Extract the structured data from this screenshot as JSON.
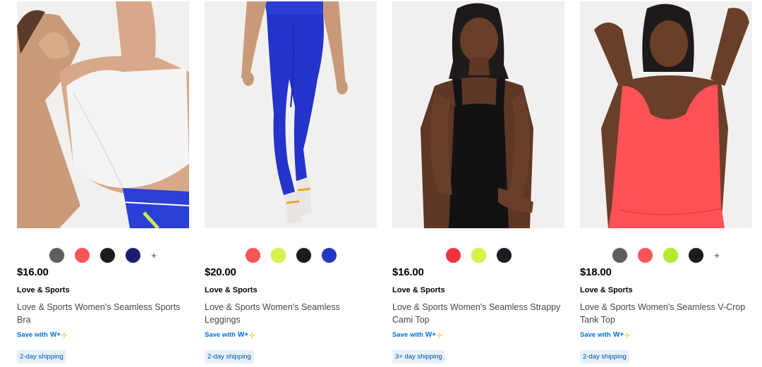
{
  "products": [
    {
      "image_alt": "Woman wearing white seamless sports bra",
      "swatches": [
        "#5c5f60",
        "#fb5457",
        "#1b1c1f",
        "#1c1e6e"
      ],
      "more_label": "+",
      "price": "$16.00",
      "brand": "Love & Sports",
      "title": "Love & Sports Women's Seamless Sports Bra",
      "save_label": "Save with",
      "wplus_label": "W+",
      "shipping": "2-day shipping"
    },
    {
      "image_alt": "Woman wearing blue seamless leggings",
      "swatches": [
        "#fb5457",
        "#d6f24a",
        "#1b1c1f",
        "#2438c2"
      ],
      "more_label": "",
      "price": "$20.00",
      "brand": "Love & Sports",
      "title": "Love & Sports Women's Seamless Leggings",
      "save_label": "Save with",
      "wplus_label": "W+",
      "shipping": "2-day shipping"
    },
    {
      "image_alt": "Woman wearing black seamless strappy cami top",
      "swatches": [
        "#f5333b",
        "#d6f24a",
        "#1b1c1f"
      ],
      "more_label": "",
      "price": "$16.00",
      "brand": "Love & Sports",
      "title": "Love & Sports Women's Seamless Strappy Cami Top",
      "save_label": "Save with",
      "wplus_label": "W+",
      "shipping": "3+ day shipping"
    },
    {
      "image_alt": "Woman wearing coral seamless v-crop tank top",
      "swatches": [
        "#5c5f60",
        "#fb5457",
        "#b6e82c",
        "#1b1c1f"
      ],
      "more_label": "+",
      "price": "$18.00",
      "brand": "Love & Sports",
      "title": "Love & Sports Women's Seamless V-Crop Tank Top",
      "save_label": "Save with",
      "wplus_label": "W+",
      "shipping": "2-day shipping"
    }
  ],
  "colors": {
    "link_blue": "#0071dc",
    "shipping_bg": "#e6f1fc",
    "wplus_spark": "#ffc220"
  }
}
